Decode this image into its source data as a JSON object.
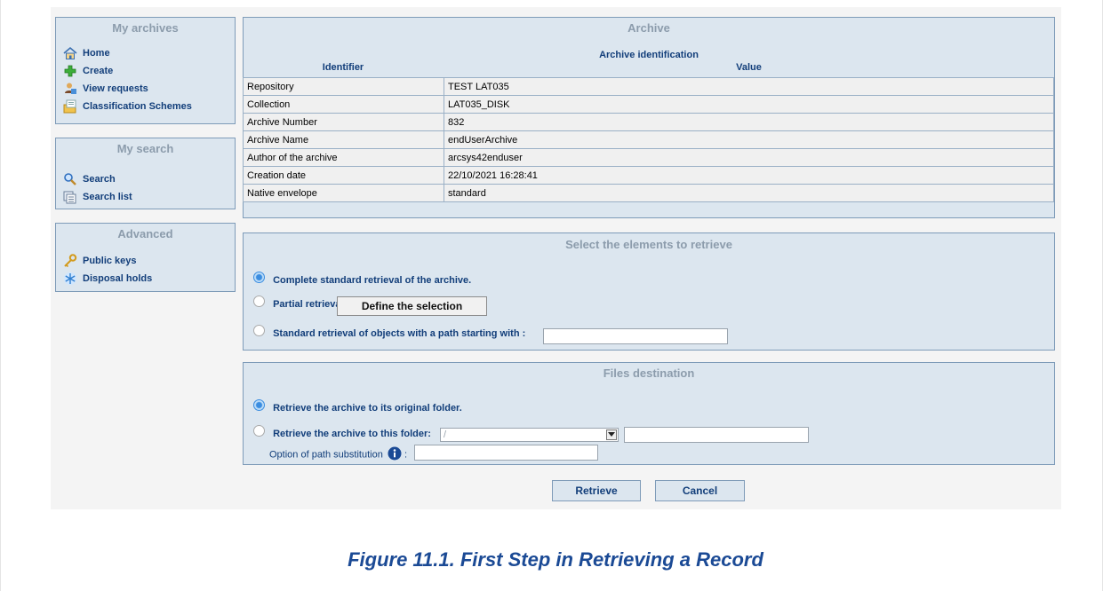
{
  "sidebar": {
    "my_archives": {
      "title": "My archives",
      "items": [
        {
          "label": "Home",
          "icon": "home-icon"
        },
        {
          "label": "Create",
          "icon": "plus-icon"
        },
        {
          "label": "View requests",
          "icon": "requests-icon"
        },
        {
          "label": "Classification Schemes",
          "icon": "folder-icon"
        }
      ]
    },
    "my_search": {
      "title": "My search",
      "items": [
        {
          "label": "Search",
          "icon": "magnifier-icon"
        },
        {
          "label": "Search list",
          "icon": "list-icon"
        }
      ]
    },
    "advanced": {
      "title": "Advanced",
      "items": [
        {
          "label": "Public keys",
          "icon": "key-icon"
        },
        {
          "label": "Disposal holds",
          "icon": "snowflake-icon"
        }
      ]
    }
  },
  "archive": {
    "title": "Archive",
    "subtitle": "Archive identification",
    "col_identifier": "Identifier",
    "col_value": "Value",
    "rows": [
      {
        "k": "Repository",
        "v": "TEST LAT035"
      },
      {
        "k": "Collection",
        "v": "LAT035_DISK"
      },
      {
        "k": "Archive Number",
        "v": "832"
      },
      {
        "k": "Archive Name",
        "v": "endUserArchive"
      },
      {
        "k": "Author of the archive",
        "v": "arcsys42enduser"
      },
      {
        "k": "Creation date",
        "v": "22/10/2021 16:28:41"
      },
      {
        "k": "Native envelope",
        "v": "standard"
      }
    ]
  },
  "retrieve": {
    "title": "Select the elements to retrieve",
    "opt_complete": "Complete standard retrieval of the archive.",
    "opt_partial": "Partial retrieval.",
    "define_button": "Define the selection",
    "opt_path": "Standard retrieval of objects with a path starting with :",
    "path_value": ""
  },
  "destination": {
    "title": "Files destination",
    "opt_original": "Retrieve the archive to its original folder.",
    "opt_folder": "Retrieve the archive to this folder:",
    "folder_select_value": "/",
    "folder_text_value": "",
    "substitution_label": "Option of path substitution",
    "substitution_value": ""
  },
  "actions": {
    "retrieve": "Retrieve",
    "cancel": "Cancel"
  },
  "caption": "Figure 11.1. First Step in Retrieving a Record",
  "colors": {
    "panel_bg": "#dce6ef",
    "panel_border": "#7e9bb8",
    "link_blue": "#123e7a",
    "caption_blue": "#1b4a95"
  }
}
